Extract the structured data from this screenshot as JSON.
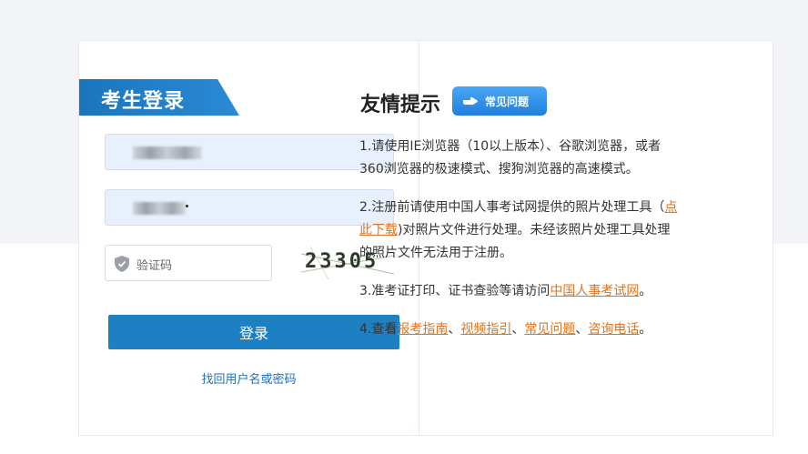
{
  "login": {
    "title": "考生登录",
    "captcha_placeholder": "验证码",
    "captcha_code": "23305",
    "submit_label": "登录",
    "retrieve_label": "找回用户名或密码"
  },
  "tips": {
    "title": "友情提示",
    "faq_badge": "常见问题",
    "items": [
      {
        "text": "1.请使用IE浏览器（10以上版本）、谷歌浏览器，或者360浏览器的极速模式、搜狗浏览器的高速模式。"
      },
      {
        "pre": "2.注册前请使用中国人事考试网提供的照片处理工具（",
        "link": "点此下载",
        "post": ")对照片文件进行处理。未经该照片处理工具处理的照片文件无法用于注册。"
      },
      {
        "pre": "3.准考证打印、证书查验等请访问",
        "link": "中国人事考试网",
        "post": "。"
      },
      {
        "pre": "4.查看",
        "links": [
          "报考指南",
          "视频指引",
          "常见问题",
          "咨询电话"
        ],
        "sep": "、",
        "post": "。"
      }
    ]
  },
  "colors": {
    "primary": "#1d80c3",
    "link_orange": "#e0741f"
  },
  "icons": {
    "shield": "shield-icon",
    "hand": "pointing-hand-icon"
  }
}
